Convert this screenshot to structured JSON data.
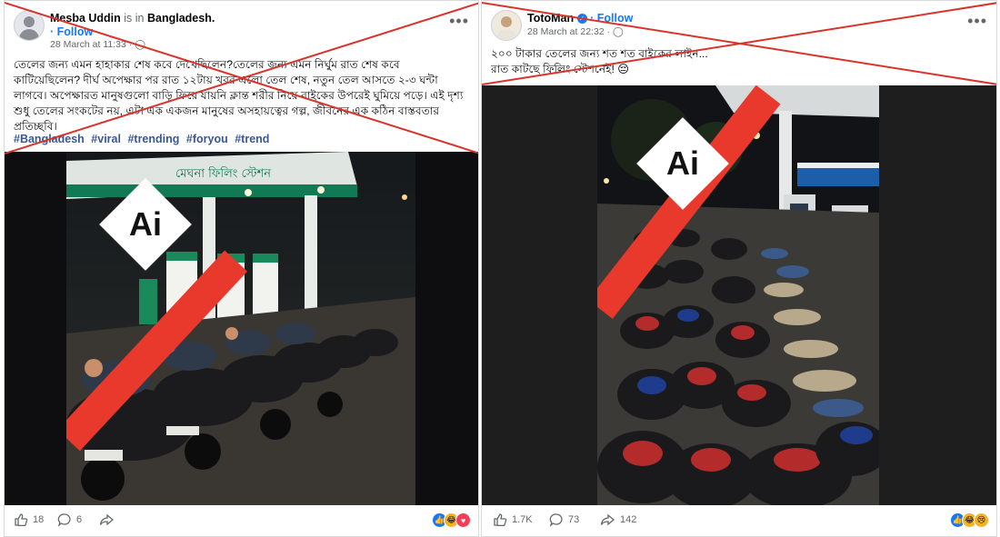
{
  "left_post": {
    "author": "Mesba Uddin",
    "location_prefix": "is in",
    "location": "Bangladesh.",
    "follow": "· Follow",
    "time": "28 March at 11:33 · ",
    "text": "তেলের জন্য এমন হাহাকার শেষ কবে দেখেছিলেন?তেলের জন্য এমন নির্ঘুম রাত শেষ কবে কাটিয়েছিলেন? দীর্ঘ অপেক্ষার পর রাত ১২টায় খবর এলো তেল শেষ, নতুন তেল আসতে ২-৩ ঘন্টা লাগবে। অপেক্ষারত মানুষগুলো বাড়ি ফিরে যায়নি ক্লান্ত শরীর নিয়ে বাইকের উপরেই ঘুমিয়ে পড়ে। এই দৃশ্য শুধু তেলের সংকটের নয়, এটা এক একজন মানুষের অসহায়ত্বের গল্প, জীবনের এক কঠিন বাস্তবতার প্রতিচ্ছবি।",
    "hashtags": [
      "#Bangladesh",
      "#viral",
      "#trending",
      "#foryou",
      "#trend"
    ],
    "station_sign": "মেঘনা ফিলিং স্টেশন",
    "ai_badge": "Ai",
    "likes": "18",
    "comments": "6",
    "icons": [
      "like-icon",
      "comment-icon",
      "share-icon"
    ]
  },
  "right_post": {
    "author": "TotoMan",
    "follow": "· Follow",
    "time": "28 March at 22:32 · ",
    "text_line1": "২০০ টাকার তেলের জন্য শত শত বাইকের লাইন...",
    "text_line2": "রাত কাটছে ফিলিং স্টেশনেই!",
    "emoji": "😔",
    "ai_badge": "Ai",
    "likes": "1.7K",
    "comments": "73",
    "shares": "142"
  },
  "colors": {
    "cross_red": "#d9342b",
    "stripe_red": "#e8392c",
    "link_blue": "#1877f2",
    "hashtag_blue": "#385898"
  }
}
